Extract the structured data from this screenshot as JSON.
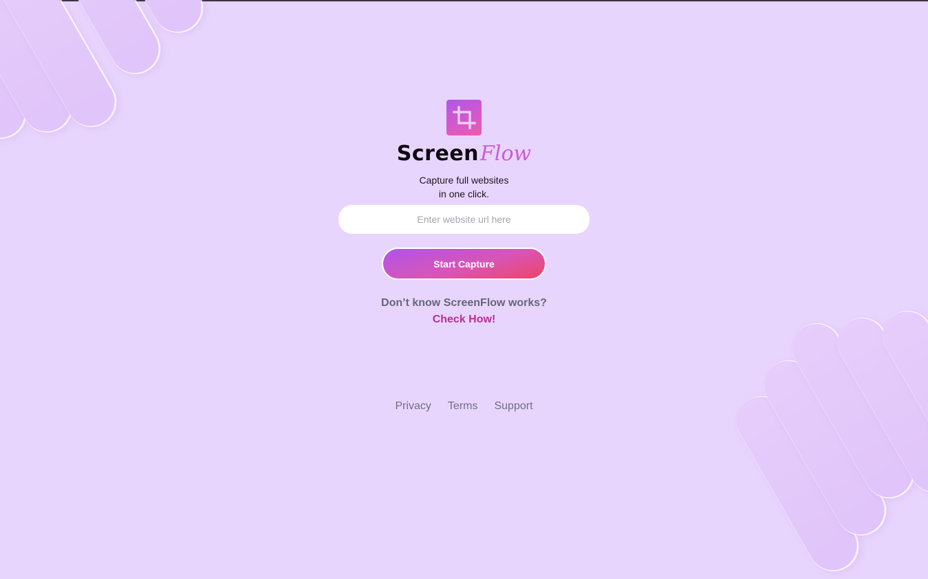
{
  "brand": {
    "name_part1": "Screen",
    "name_part2": "Flow",
    "logo_icon": "crop-icon"
  },
  "tagline": {
    "line1": "Capture full websites",
    "line2": "in one click."
  },
  "url_input": {
    "placeholder": "Enter website url here",
    "value": ""
  },
  "start_button": {
    "label": "Start Capture"
  },
  "help": {
    "question": "Don’t know ScreenFlow works?",
    "link_label": "Check How!"
  },
  "footer": {
    "links": [
      "Privacy",
      "Terms",
      "Support"
    ]
  },
  "colors": {
    "background": "#e8d5fd",
    "accent_purple": "#b356ea",
    "accent_pink": "#ee5ab1",
    "accent_red": "#ef4468",
    "link": "#b92e93"
  }
}
